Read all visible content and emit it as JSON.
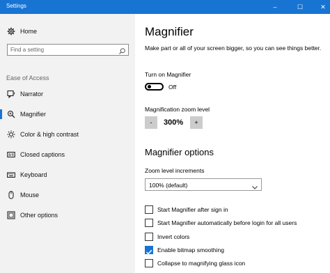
{
  "window": {
    "title": "Settings",
    "controls": {
      "minimize": "–",
      "maximize": "☐",
      "close": "✕"
    }
  },
  "sidebar": {
    "home_label": "Home",
    "search_placeholder": "Find a setting",
    "section_label": "Ease of Access",
    "items": [
      {
        "label": "Narrator",
        "icon": "narrator-icon"
      },
      {
        "label": "Magnifier",
        "icon": "magnifier-icon",
        "selected": true
      },
      {
        "label": "Color & high contrast",
        "icon": "brightness-icon"
      },
      {
        "label": "Closed captions",
        "icon": "closed-captions-icon"
      },
      {
        "label": "Keyboard",
        "icon": "keyboard-icon"
      },
      {
        "label": "Mouse",
        "icon": "mouse-icon"
      },
      {
        "label": "Other options",
        "icon": "other-options-icon"
      }
    ]
  },
  "main": {
    "title": "Magnifier",
    "description": "Make part or all of your screen bigger, so you can see things better.",
    "toggle": {
      "label": "Turn on Magnifier",
      "state_text": "Off",
      "on": false
    },
    "zoom": {
      "label": "Magnification zoom level",
      "minus": "-",
      "value": "300%",
      "plus": "+"
    },
    "options_title": "Magnifier options",
    "increments": {
      "label": "Zoom level increments",
      "selected": "100% (default)"
    },
    "checkboxes": [
      {
        "label": "Start Magnifier after sign in",
        "checked": false
      },
      {
        "label": "Start Magnifier automatically before login for all users",
        "checked": false
      },
      {
        "label": "Invert colors",
        "checked": false
      },
      {
        "label": "Enable bitmap smoothing",
        "checked": true
      },
      {
        "label": "Collapse to magnifying glass icon",
        "checked": false
      }
    ]
  },
  "colors": {
    "accent": "#1874d3",
    "sidebar_bg": "#f2f2f2",
    "button_bg": "#cccccc"
  }
}
